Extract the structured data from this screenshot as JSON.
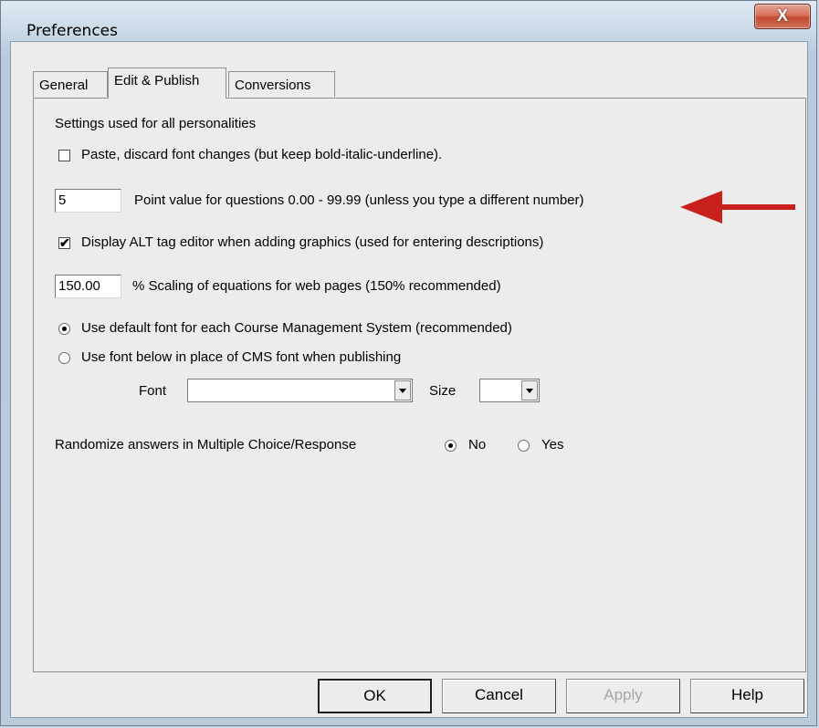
{
  "window": {
    "title": "Preferences",
    "close_label": "X"
  },
  "tabs": [
    {
      "label": "General",
      "active": false
    },
    {
      "label": "Edit & Publish",
      "active": true
    },
    {
      "label": "Conversions",
      "active": false
    }
  ],
  "panel": {
    "heading": "Settings used for all personalities",
    "paste_option": {
      "label": "Paste, discard font changes (but keep bold-italic-underline).",
      "checked": false
    },
    "point_value": {
      "value": "5",
      "label": "Point value for questions 0.00 - 99.99  (unless you type a different number)"
    },
    "alt_tag_option": {
      "label": "Display ALT tag editor when adding graphics (used for entering descriptions)",
      "checked": true
    },
    "scaling": {
      "value": "150.00",
      "label": "%  Scaling of equations for web pages (150% recommended)"
    },
    "font_choice": {
      "default_label": "Use default font for each Course Management System (recommended)",
      "custom_label": "Use font below in place of CMS font when publishing",
      "selected": "default"
    },
    "font_label": "Font",
    "font_value": "",
    "size_label": "Size",
    "size_value": "",
    "randomize": {
      "label": "Randomize answers in Multiple Choice/Response",
      "no_label": "No",
      "yes_label": "Yes",
      "selected": "No"
    }
  },
  "buttons": {
    "ok": "OK",
    "cancel": "Cancel",
    "apply": "Apply",
    "help": "Help"
  },
  "colors": {
    "annotation_arrow": "#c8201c",
    "close_button": "#c94a33"
  },
  "icons": {
    "close": "close-icon",
    "annotation": "red-arrow-icon"
  }
}
